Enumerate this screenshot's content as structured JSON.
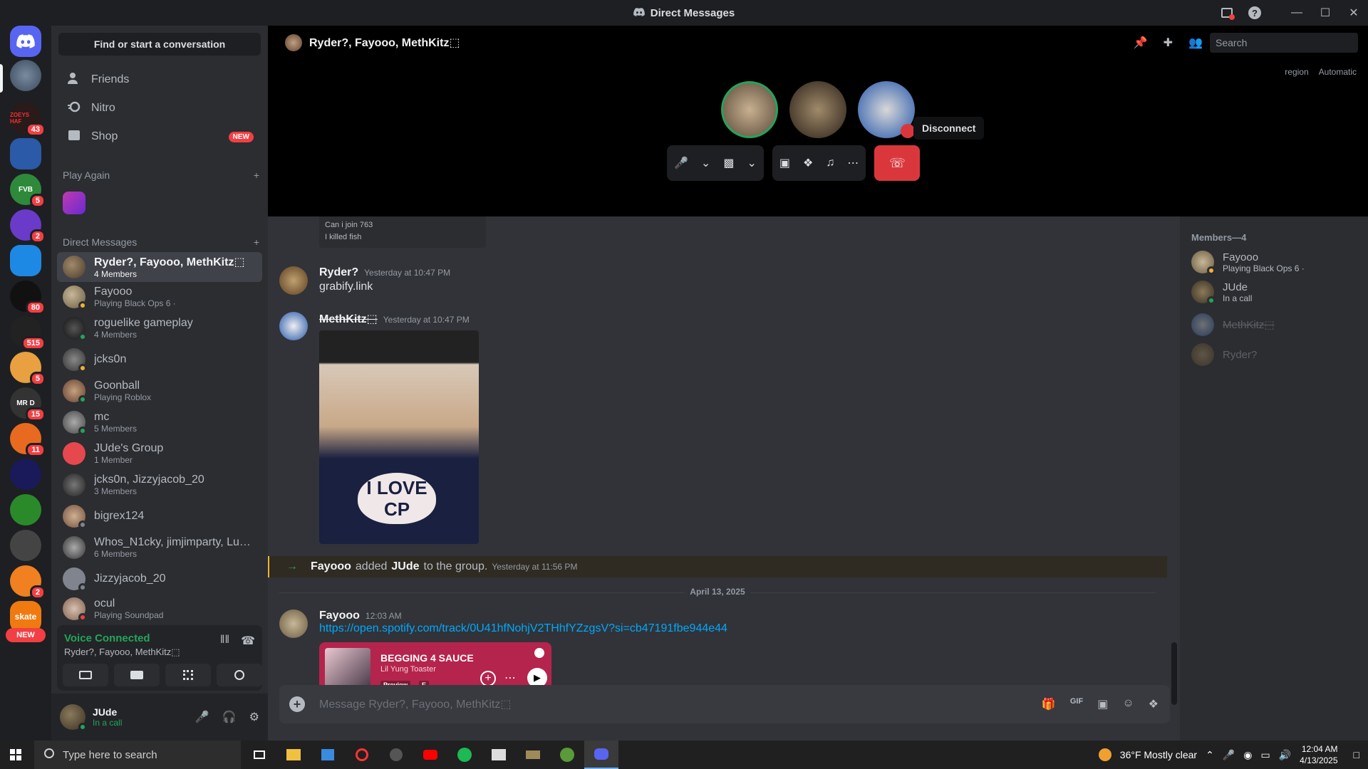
{
  "window": {
    "title": "Direct Messages"
  },
  "dm_panel": {
    "search_label": "Find or start a conversation",
    "nav": [
      {
        "label": "Friends",
        "icon": "friends-icon"
      },
      {
        "label": "Nitro",
        "icon": "nitro-icon"
      },
      {
        "label": "Shop",
        "icon": "shop-icon",
        "badge": "NEW"
      }
    ],
    "play_again_label": "Play Again",
    "dm_header": "Direct Messages",
    "dms": [
      {
        "name": "Ryder?, Fayooo, MethKitz⬚",
        "sub": "4 Members",
        "active": true
      },
      {
        "name": "Fayooo",
        "sub": "Playing Black Ops 6 ·"
      },
      {
        "name": "roguelike gameplay",
        "sub": "4 Members"
      },
      {
        "name": "jcks0n",
        "sub": ""
      },
      {
        "name": "Goonball",
        "sub": "Playing Roblox"
      },
      {
        "name": "mc",
        "sub": "5 Members"
      },
      {
        "name": "JUde's Group",
        "sub": "1 Member"
      },
      {
        "name": "jcks0n, Jizzyjacob_20",
        "sub": "3 Members"
      },
      {
        "name": "bigrex124",
        "sub": ""
      },
      {
        "name": "Whos_N1cky, jimjimparty, Luc...",
        "sub": "6 Members"
      },
      {
        "name": "Jizzyjacob_20",
        "sub": ""
      },
      {
        "name": "ocul",
        "sub": "Playing Soundpad"
      }
    ]
  },
  "servers": {
    "badges": [
      "43",
      "5",
      "2",
      "80",
      "515",
      "5",
      "15",
      "11",
      "2"
    ],
    "labels": [
      "ZOEYS HAF",
      "FVB",
      "MR D",
      "skate",
      "NEW"
    ]
  },
  "voice": {
    "status": "Voice Connected",
    "channel": "Ryder?, Fayooo, MethKitz⬚"
  },
  "user": {
    "name": "JUde",
    "status": "In a call"
  },
  "channel": {
    "title": "Ryder?, Fayooo, MethKitz⬚",
    "search_placeholder": "Search",
    "region_label": "region",
    "region_value": "Automatic"
  },
  "call": {
    "tooltip": "Disconnect"
  },
  "messages": {
    "prev_snippet_1": "Can i join 763",
    "prev_snippet_2": "I killed fish",
    "m1": {
      "author": "Ryder?",
      "time": "Yesterday at 10:47 PM",
      "text": "grabify.link"
    },
    "m2": {
      "author": "MethKitz⬚",
      "time": "Yesterday at 10:47 PM",
      "image_text": "I LOVE CP"
    },
    "system": {
      "actor": "Fayooo",
      "verb": "added",
      "target": "JUde",
      "rest": "to the group.",
      "time": "Yesterday at 11:56 PM"
    },
    "date_divider": "April 13, 2025",
    "m3": {
      "author": "Fayooo",
      "time": "12:03 AM",
      "link": "https://open.spotify.com/track/0U41hfNohjV2THhfYZzgsV?si=cb47191fbe944e44",
      "embed_title": "BEGGING 4 SAUCE",
      "embed_artist": "Lil Yung Toaster",
      "embed_preview": "Preview",
      "embed_explicit": "E"
    }
  },
  "composer": {
    "placeholder": "Message Ryder?, Fayooo, MethKitz⬚"
  },
  "members": {
    "header": "Members—4",
    "list": [
      {
        "name": "Fayooo",
        "sub": "Playing Black Ops 6 ·"
      },
      {
        "name": "JUde",
        "sub": "In a call"
      },
      {
        "name": "MethKitz⬚",
        "sub": ""
      },
      {
        "name": "Ryder?",
        "sub": ""
      }
    ]
  },
  "taskbar": {
    "search_placeholder": "Type here to search",
    "weather": "36°F  Mostly clear",
    "time": "12:04 AM",
    "date": "4/13/2025"
  },
  "colors": {
    "accent": "#5865f2",
    "online": "#23a55a",
    "danger": "#da373c",
    "link": "#00a8fc"
  }
}
